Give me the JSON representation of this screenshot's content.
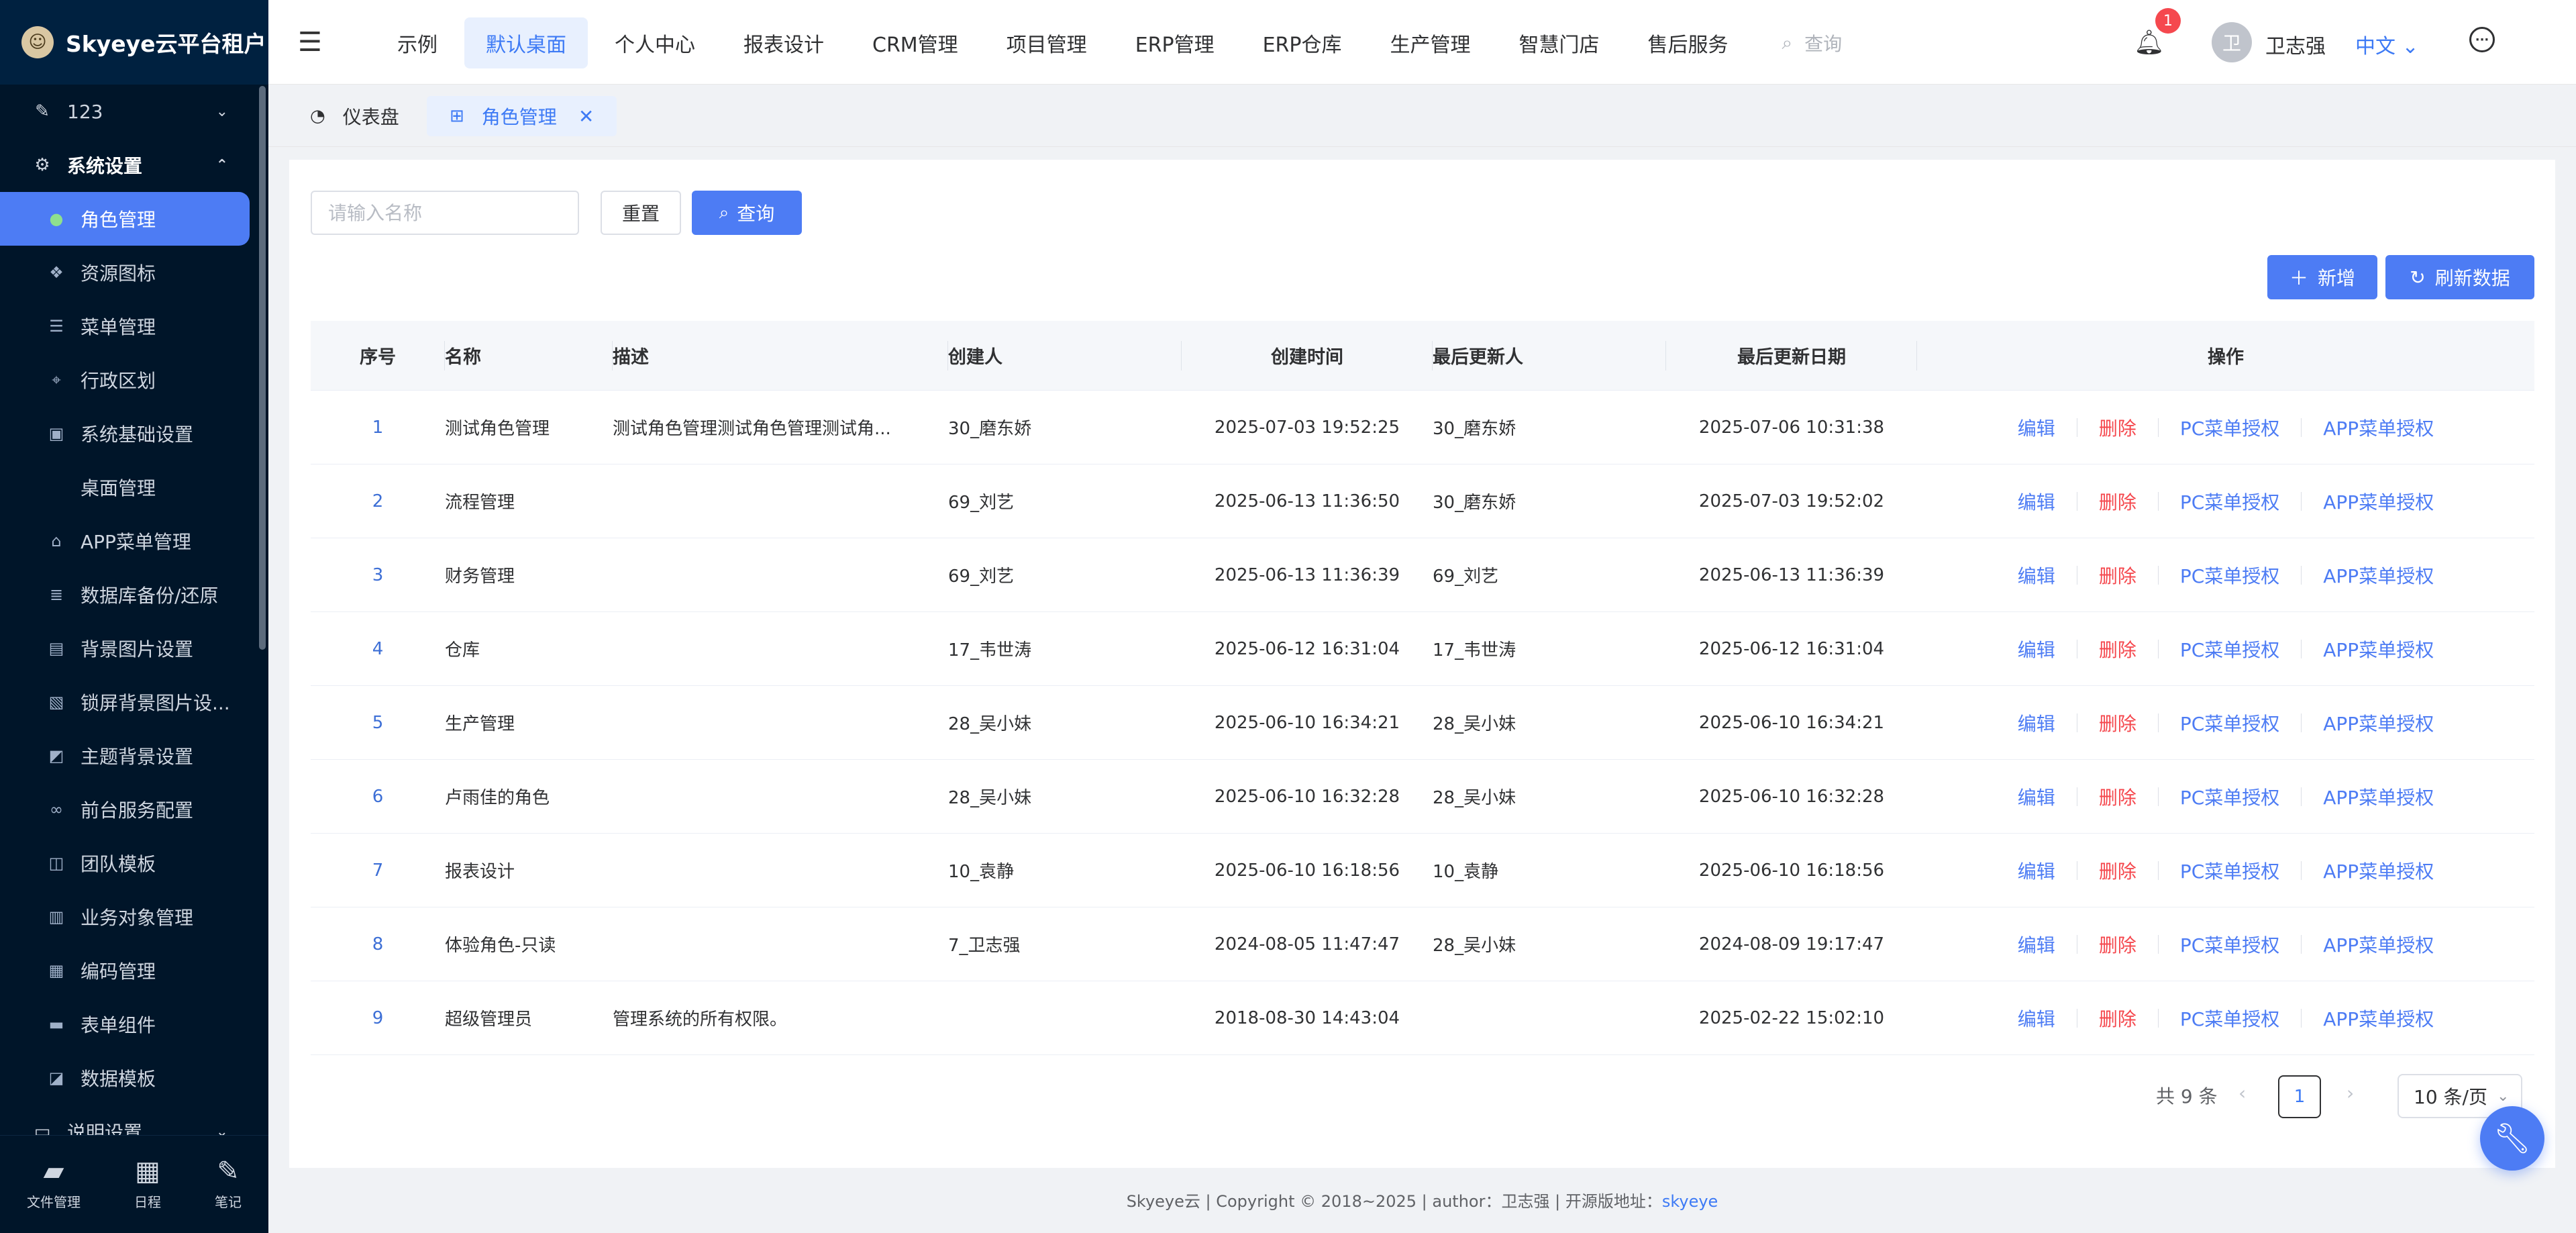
{
  "app": {
    "title": "Skyeye云平台租户"
  },
  "sidebar": {
    "groups": [
      {
        "label": "123",
        "icon": "edit-icon",
        "state": "collapsed"
      },
      {
        "label": "系统设置",
        "icon": "gear-icon",
        "state": "expanded"
      }
    ],
    "items": [
      {
        "label": "角色管理",
        "icon": "circle-icon",
        "active": true
      },
      {
        "label": "资源图标",
        "icon": "resource-icon"
      },
      {
        "label": "菜单管理",
        "icon": "menu-icon"
      },
      {
        "label": "行政区划",
        "icon": "map-icon"
      },
      {
        "label": "系统基础设置",
        "icon": "settings-icon"
      },
      {
        "label": "桌面管理",
        "icon": ""
      },
      {
        "label": "APP菜单管理",
        "icon": "android-icon"
      },
      {
        "label": "数据库备份/还原",
        "icon": "database-icon"
      },
      {
        "label": "背景图片设置",
        "icon": "image-icon"
      },
      {
        "label": "锁屏背景图片设...",
        "icon": "lock-image-icon"
      },
      {
        "label": "主题背景设置",
        "icon": "theme-icon"
      },
      {
        "label": "前台服务配置",
        "icon": "link-icon"
      },
      {
        "label": "团队模板",
        "icon": "team-icon"
      },
      {
        "label": "业务对象管理",
        "icon": "object-icon"
      },
      {
        "label": "编码管理",
        "icon": "code-icon"
      },
      {
        "label": "表单组件",
        "icon": "form-icon"
      },
      {
        "label": "数据模板",
        "icon": "template-icon"
      },
      {
        "label": "说明设置",
        "icon": "doc-icon"
      }
    ],
    "dock": [
      {
        "label": "文件管理",
        "icon": "folder-icon"
      },
      {
        "label": "日程",
        "icon": "calendar-icon"
      },
      {
        "label": "笔记",
        "icon": "note-icon"
      }
    ]
  },
  "header": {
    "tabs": [
      "示例",
      "默认桌面",
      "个人中心",
      "报表设计",
      "CRM管理",
      "项目管理",
      "ERP管理",
      "ERP仓库",
      "生产管理",
      "智慧门店",
      "售后服务"
    ],
    "active_tab": "默认桌面",
    "search_placeholder": "查询",
    "notification_count": "1",
    "avatar_char": "卫",
    "username": "卫志强",
    "language": "中文"
  },
  "tabbar": {
    "items": [
      {
        "label": "仪表盘",
        "icon": "dashboard-icon"
      },
      {
        "label": "角色管理",
        "icon": "grid-icon",
        "active": true
      }
    ]
  },
  "filters": {
    "name_placeholder": "请输入名称",
    "reset_label": "重置",
    "query_label": "查询"
  },
  "toolbar": {
    "add_label": "新增",
    "refresh_label": "刷新数据"
  },
  "table": {
    "columns": [
      "序号",
      "名称",
      "描述",
      "创建人",
      "创建时间",
      "最后更新人",
      "最后更新日期",
      "操作"
    ],
    "actions": [
      "编辑",
      "删除",
      "PC菜单授权",
      "APP菜单授权"
    ],
    "rows": [
      {
        "idx": "1",
        "name": "测试角色管理",
        "desc": "测试角色管理测试角色管理测试角...",
        "creator": "30_磨东娇",
        "created": "2025-07-03 19:52:25",
        "updater": "30_磨东娇",
        "updated": "2025-07-06 10:31:38"
      },
      {
        "idx": "2",
        "name": "流程管理",
        "desc": "",
        "creator": "69_刘艺",
        "created": "2025-06-13 11:36:50",
        "updater": "30_磨东娇",
        "updated": "2025-07-03 19:52:02"
      },
      {
        "idx": "3",
        "name": "财务管理",
        "desc": "",
        "creator": "69_刘艺",
        "created": "2025-06-13 11:36:39",
        "updater": "69_刘艺",
        "updated": "2025-06-13 11:36:39"
      },
      {
        "idx": "4",
        "name": "仓库",
        "desc": "",
        "creator": "17_韦世涛",
        "created": "2025-06-12 16:31:04",
        "updater": "17_韦世涛",
        "updated": "2025-06-12 16:31:04"
      },
      {
        "idx": "5",
        "name": "生产管理",
        "desc": "",
        "creator": "28_吴小妹",
        "created": "2025-06-10 16:34:21",
        "updater": "28_吴小妹",
        "updated": "2025-06-10 16:34:21"
      },
      {
        "idx": "6",
        "name": "卢雨佳的角色",
        "desc": "",
        "creator": "28_吴小妹",
        "created": "2025-06-10 16:32:28",
        "updater": "28_吴小妹",
        "updated": "2025-06-10 16:32:28"
      },
      {
        "idx": "7",
        "name": "报表设计",
        "desc": "",
        "creator": "10_袁静",
        "created": "2025-06-10 16:18:56",
        "updater": "10_袁静",
        "updated": "2025-06-10 16:18:56"
      },
      {
        "idx": "8",
        "name": "体验角色-只读",
        "desc": "",
        "creator": "7_卫志强",
        "created": "2024-08-05 11:47:47",
        "updater": "28_吴小妹",
        "updated": "2024-08-09 19:17:47"
      },
      {
        "idx": "9",
        "name": "超级管理员",
        "desc": "管理系统的所有权限。",
        "creator": "",
        "created": "2018-08-30 14:43:04",
        "updater": "",
        "updated": "2025-02-22 15:02:10"
      }
    ]
  },
  "pagination": {
    "total_text": "共 9 条",
    "current_page": "1",
    "page_size": "10 条/页"
  },
  "footer": {
    "text": "Skyeye云 | Copyright © 2018~2025 | author：卫志强 | 开源版地址：",
    "link": "skyeye"
  },
  "colors": {
    "primary": "#4d7cf4",
    "danger": "#f5484e",
    "sidebar_bg": "#001529"
  }
}
